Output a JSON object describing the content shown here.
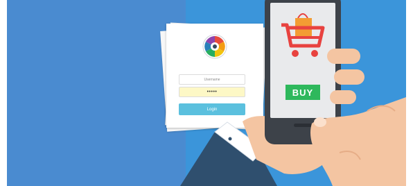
{
  "login_form": {
    "username_placeholder": "Username",
    "password_value": "•••••",
    "login_label": "Login"
  },
  "phone": {
    "buy_label": "BUY"
  },
  "colors": {
    "left_background": "#4a8bd0",
    "right_background": "#3b95da",
    "login_button": "#5bc0de",
    "password_field": "#fdf8c6",
    "buy_button": "#2eb85c",
    "cart": "#e8423f",
    "bag": "#f39c33",
    "skin": "#f4c5a2",
    "sleeve": "#2f4f6e"
  },
  "icons": {
    "logo": "colorful-circle-logo-icon",
    "cart": "shopping-cart-icon",
    "bag": "shopping-bag-icon"
  }
}
